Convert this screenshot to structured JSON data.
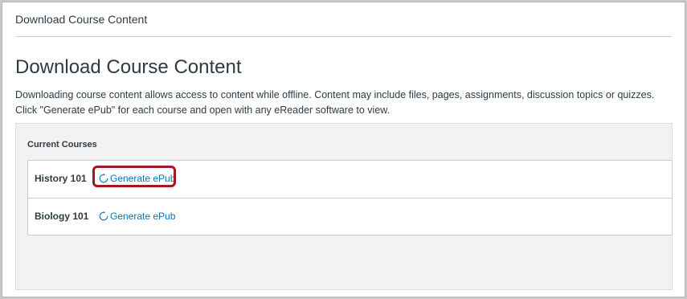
{
  "breadcrumb": {
    "label": "Download Course Content"
  },
  "page": {
    "title": "Download Course Content",
    "description": "Downloading course content allows access to content while offline. Content may include files, pages, assignments, discussion topics or quizzes. Click \"Generate ePub\" for each course and open with any eReader software to view."
  },
  "courses": {
    "heading": "Current Courses",
    "items": [
      {
        "name": "History 101",
        "action_label": "Generate ePub",
        "action_icon": "refresh-icon"
      },
      {
        "name": "Biology 101",
        "action_label": "Generate ePub",
        "action_icon": "refresh-icon"
      }
    ]
  },
  "colors": {
    "link": "#0b74b5",
    "text": "#2d3b45",
    "highlight": "#9e1b22",
    "panel_bg": "#f2f2f2"
  }
}
